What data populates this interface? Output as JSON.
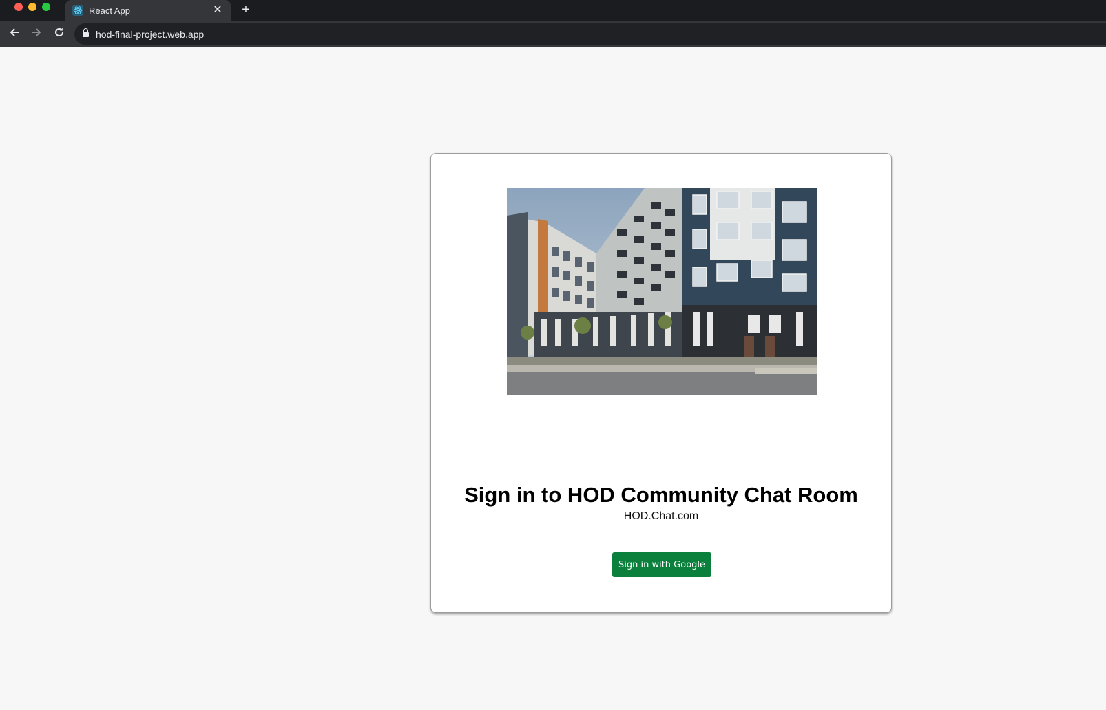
{
  "browser": {
    "tab_title": "React App",
    "url": "hod-final-project.web.app",
    "new_tab_glyph": "+",
    "close_glyph": "✕",
    "icons": {
      "back": "arrow-left-icon",
      "forward": "arrow-right-icon",
      "reload": "reload-icon",
      "lock": "lock-icon",
      "favicon": "react-logo-icon"
    }
  },
  "signin": {
    "image": "apartment-building-photo",
    "title": "Sign in to HOD Community Chat Room",
    "subtitle": "HOD.Chat.com",
    "button_label": "Sign in with Google",
    "button_color": "#0b7f3c"
  }
}
